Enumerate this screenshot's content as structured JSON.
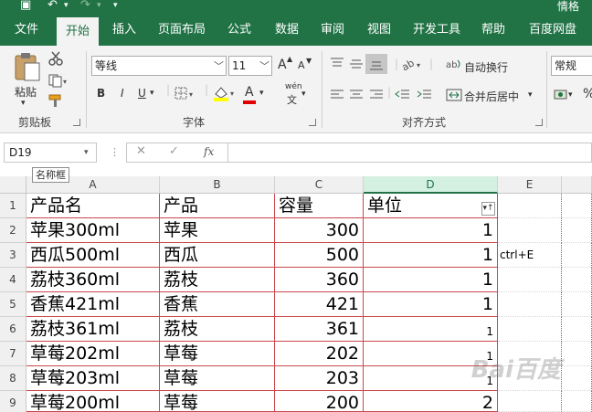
{
  "titlebar": {
    "user": "情格"
  },
  "tabs": [
    {
      "label": "文件"
    },
    {
      "label": "开始"
    },
    {
      "label": "插入"
    },
    {
      "label": "页面布局"
    },
    {
      "label": "公式"
    },
    {
      "label": "数据"
    },
    {
      "label": "审阅"
    },
    {
      "label": "视图"
    },
    {
      "label": "开发工具"
    },
    {
      "label": "帮助"
    },
    {
      "label": "百度网盘"
    }
  ],
  "ribbon": {
    "clipboard": {
      "paste": "粘贴",
      "label": "剪贴板"
    },
    "font": {
      "name": "等线",
      "size": "11",
      "grow": "A",
      "shrink": "A",
      "bold": "B",
      "italic": "I",
      "underline": "U",
      "font_color": "A",
      "label": "字体",
      "wen": "wén"
    },
    "align": {
      "wrap": "自动换行",
      "merge": "合并后居中",
      "label": "对齐方式"
    },
    "number": {
      "format": "常规",
      "percent": "%"
    }
  },
  "formula_bar": {
    "namebox": "D19",
    "tooltip": "名称框",
    "fx": "fx",
    "cancel": "✕",
    "enter": "✓"
  },
  "columns": [
    "A",
    "B",
    "C",
    "D",
    "E"
  ],
  "headers": {
    "a": "产品名",
    "b": "产品",
    "c": "容量",
    "d": "单位"
  },
  "rows": [
    {
      "num": "1"
    },
    {
      "num": "2",
      "a": "苹果300ml",
      "b": "苹果",
      "c": "300",
      "d": "1"
    },
    {
      "num": "3",
      "a": "西瓜500ml",
      "b": "西瓜",
      "c": "500",
      "d": "1",
      "e": "ctrl+E"
    },
    {
      "num": "4",
      "a": "荔枝360ml",
      "b": "荔枝",
      "c": "360",
      "d": "1"
    },
    {
      "num": "5",
      "a": "香蕉421ml",
      "b": "香蕉",
      "c": "421",
      "d": "1"
    },
    {
      "num": "6",
      "a": "荔枝361ml",
      "b": "荔枝",
      "c": "361",
      "d": "1"
    },
    {
      "num": "7",
      "a": "草莓202ml",
      "b": "草莓",
      "c": "202",
      "d": "1"
    },
    {
      "num": "8",
      "a": "草莓203ml",
      "b": "草莓",
      "c": "203",
      "d": "1"
    },
    {
      "num": "9",
      "a": "草莓200ml",
      "b": "草莓",
      "c": "200",
      "d": "2"
    }
  ],
  "watermark": "Bai百度"
}
